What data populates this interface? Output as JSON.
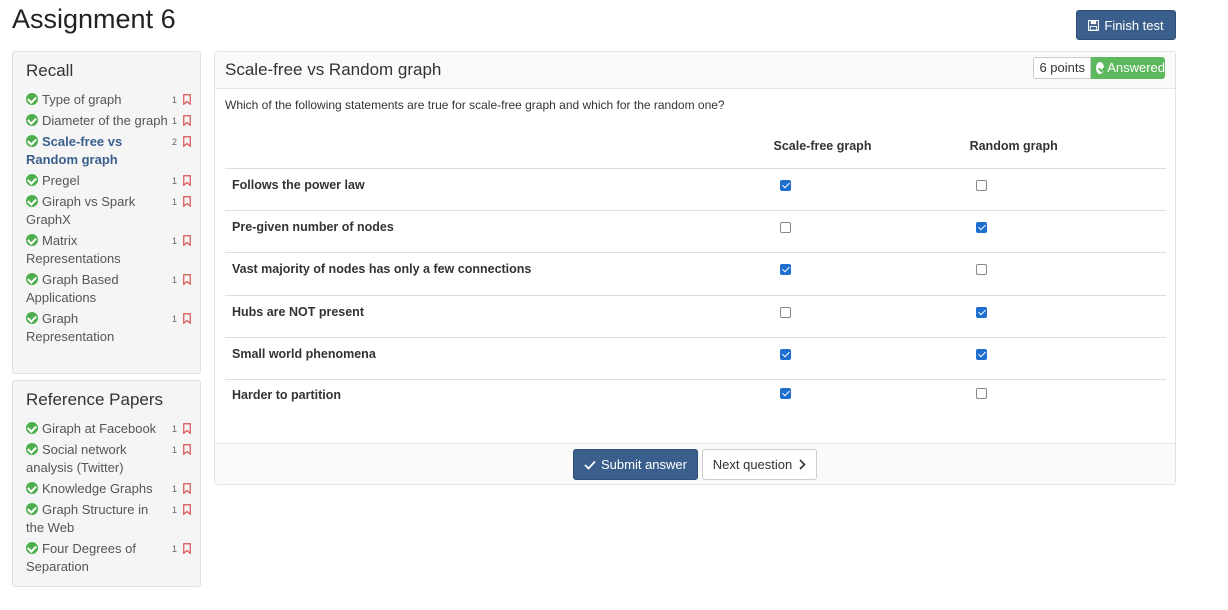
{
  "page": {
    "title": "Assignment 6"
  },
  "toolbar": {
    "finish_label": "Finish test"
  },
  "sidebar": {
    "sections": [
      {
        "heading": "Recall",
        "items": [
          {
            "label": "Type of graph",
            "points": "1",
            "current": false
          },
          {
            "label": "Diameter of the graph",
            "points": "1",
            "current": false
          },
          {
            "label": "Scale-free vs Random graph",
            "points": "2",
            "current": true
          },
          {
            "label": "Pregel",
            "points": "1",
            "current": false
          },
          {
            "label": "Giraph vs Spark GraphX",
            "points": "1",
            "current": false
          },
          {
            "label": "Matrix Representations",
            "points": "1",
            "current": false
          },
          {
            "label": "Graph Based Applications",
            "points": "1",
            "current": false
          },
          {
            "label": "Graph Representation",
            "points": "1",
            "current": false
          }
        ]
      },
      {
        "heading": "Reference Papers",
        "items": [
          {
            "label": "Giraph at Facebook",
            "points": "1",
            "current": false
          },
          {
            "label": "Social network analysis (Twitter)",
            "points": "1",
            "current": false
          },
          {
            "label": "Knowledge Graphs",
            "points": "1",
            "current": false
          },
          {
            "label": "Graph Structure in the Web",
            "points": "1",
            "current": false
          },
          {
            "label": "Four Degrees of Separation",
            "points": "1",
            "current": false
          }
        ]
      }
    ]
  },
  "question": {
    "title": "Scale-free vs Random graph",
    "points_label": "6 points",
    "status_label": "Answered",
    "prompt": "Which of the following statements are true for scale-free graph and which for the random one?",
    "columns": [
      "Scale-free graph",
      "Random graph"
    ],
    "rows": [
      {
        "statement": "Follows the power law",
        "checked": [
          true,
          false
        ]
      },
      {
        "statement": "Pre-given number of nodes",
        "checked": [
          false,
          true
        ]
      },
      {
        "statement": "Vast majority of nodes has only a few connections",
        "checked": [
          true,
          false
        ]
      },
      {
        "statement": "Hubs are NOT present",
        "checked": [
          false,
          true
        ]
      },
      {
        "statement": "Small world phenomena",
        "checked": [
          true,
          true
        ]
      },
      {
        "statement": "Harder to partition",
        "checked": [
          true,
          false
        ]
      }
    ],
    "submit_label": "Submit answer",
    "next_label": "Next question"
  },
  "colors": {
    "primary": "#3a5f8c",
    "success": "#5cb85c",
    "flag": "#d9534f",
    "checkbox": "#1f6fcf"
  },
  "icons": {
    "finish": "save-icon",
    "submit": "check-icon",
    "next": "chevron-right-icon",
    "nav_status": "check-circle-icon",
    "nav_flag": "bookmark-icon"
  }
}
